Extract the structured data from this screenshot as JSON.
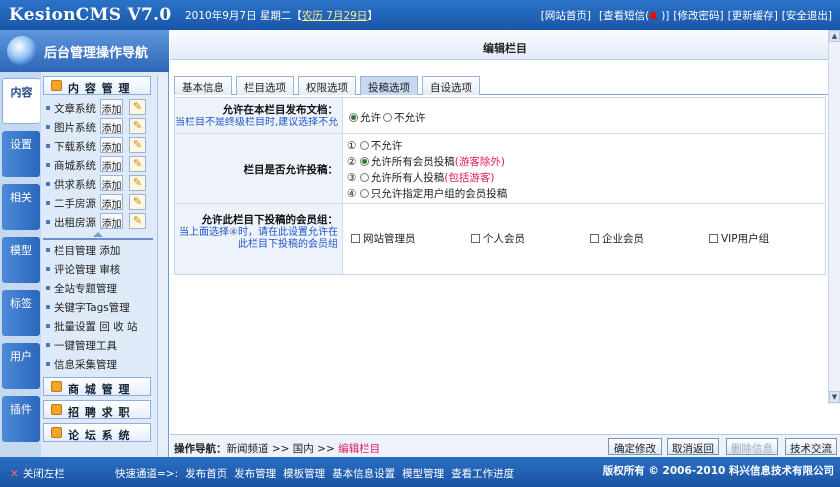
{
  "top": {
    "logo": "KesionCMS V7.0",
    "date_prefix": "2010年9月7日 星期二【",
    "lunar": "农历 7月29日",
    "date_suffix": "】",
    "links": [
      "[网站首页]",
      "[查看短信(",
      ")]",
      "[修改密码]",
      "[更新缓存]",
      "[安全退出]"
    ]
  },
  "sidebar": {
    "title": "后台管理操作导航",
    "vtabs": [
      "内容",
      "设置",
      "相关",
      "模型",
      "标签",
      "用户",
      "插件"
    ],
    "group_content": "内 容 管 理",
    "systems": [
      {
        "label": "文章系统",
        "add": "添加"
      },
      {
        "label": "图片系统",
        "add": "添加"
      },
      {
        "label": "下载系统",
        "add": "添加"
      },
      {
        "label": "商城系统",
        "add": "添加"
      },
      {
        "label": "供求系统",
        "add": "添加"
      },
      {
        "label": "二手房源",
        "add": "添加"
      },
      {
        "label": "出租房源",
        "add": "添加"
      }
    ],
    "tools": [
      "栏目管理 添加",
      "评论管理 审核",
      "全站专题管理",
      "关键字Tags管理",
      "批量设置 回 收 站",
      "一键管理工具",
      "信息采集管理"
    ],
    "groups": [
      "商 城 管 理",
      "招 聘 求 职",
      "论 坛 系 统"
    ]
  },
  "main": {
    "title": "编辑栏目",
    "tabs": [
      "基本信息",
      "栏目选项",
      "权限选项",
      "投稿选项",
      "自设选项"
    ],
    "row1": {
      "label": "允许在本栏目发布文档：",
      "hint": "当栏目不是终级栏目时,建议选择不允许",
      "yes": "允许",
      "no": "不允许"
    },
    "row2": {
      "label": "栏目是否允许投稿：",
      "n1": "①",
      "o1": "不允许",
      "n2": "②",
      "o2": "允许所有会员投稿",
      "o2red": "(游客除外)",
      "n3": "③",
      "o3": "允许所有人投稿",
      "o3red": "(包括游客)",
      "n4": "④",
      "o4": "只允许指定用户组的会员投稿"
    },
    "row3": {
      "label": "允许此栏目下投稿的会员组：",
      "hint": "当上面选择④时，请在此设置允许在此栏目下投稿的会员组",
      "groups": [
        "网站管理员",
        "个人会员",
        "企业会员",
        "VIP用户组"
      ]
    }
  },
  "ops": {
    "crumb_label": "操作导航：",
    "crumb_1": "新闻频道",
    "sep": ">>",
    "crumb_2": "国内",
    "crumb_3": "编辑栏目",
    "buttons": [
      "确定修改",
      "取消返回",
      "删除信息",
      "技术交流"
    ]
  },
  "bottom": {
    "close_left": "关闭左栏",
    "quick_label": "快速通道=>:",
    "quick": [
      "发布首页",
      "发布管理",
      "模板管理",
      "基本信息设置",
      "模型管理",
      "查看工作进度"
    ],
    "copyright": "版权所有 © 2006-2010 科兴信息技术有限公司"
  },
  "colors": {
    "accent": "#1a56a8",
    "hint_blue": "#1f56c9",
    "red": "#e0185a"
  }
}
